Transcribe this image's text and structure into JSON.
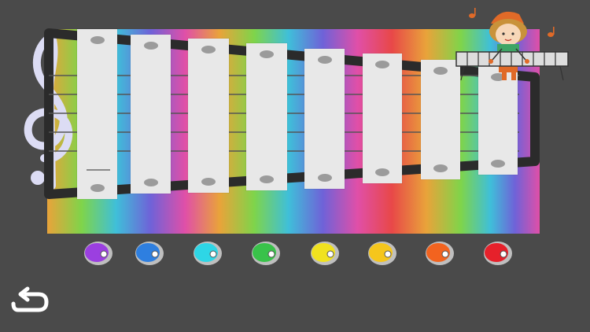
{
  "game": {
    "instrument": "xylophone",
    "bar_count": 8
  },
  "note_buttons": [
    {
      "color": "#9b3fe0"
    },
    {
      "color": "#2e7fe0"
    },
    {
      "color": "#2ed6e6"
    },
    {
      "color": "#39c24a"
    },
    {
      "color": "#f0e21f"
    },
    {
      "color": "#f5c61c"
    },
    {
      "color": "#f2631f"
    },
    {
      "color": "#e6212b"
    }
  ],
  "colors": {
    "background": "#4a4a4a",
    "bar": "#e8e8e8",
    "frame": "#2c2c2c",
    "string": "#555555"
  },
  "icons": {
    "clef": "treble-clef-icon",
    "back": "return-icon",
    "character": "girl-playing-xylophone",
    "notes": "music-note-icon"
  }
}
